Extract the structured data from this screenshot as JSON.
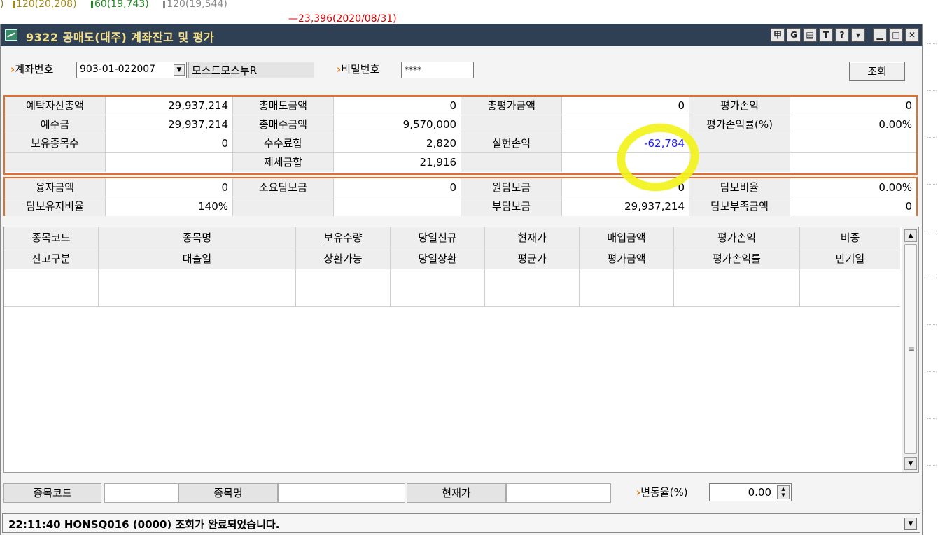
{
  "background": {
    "legend": [
      {
        "text": "120(20,208)",
        "color": "#a38a14"
      },
      {
        "text": "60(19,743)",
        "color": "#1f8a1f"
      },
      {
        "text": "120(19,544)",
        "color": "#8a8a8a"
      }
    ],
    "legend_prefix": ")",
    "annotation": "23,396(2020/08/31)"
  },
  "window": {
    "title": "9322 공매도(대주) 계좌잔고 및 평가",
    "buttons": [
      {
        "name": "pin-icon",
        "glyph": "甲"
      },
      {
        "name": "currency-icon",
        "glyph": "G"
      },
      {
        "name": "print-icon",
        "glyph": "▤"
      },
      {
        "name": "text-icon",
        "glyph": "T"
      },
      {
        "name": "help-icon",
        "glyph": "?"
      },
      {
        "name": "menu-icon",
        "glyph": "▾"
      },
      {
        "name": "minimize-icon",
        "glyph": "▁"
      },
      {
        "name": "maximize-icon",
        "glyph": "□"
      },
      {
        "name": "close-icon",
        "glyph": "✕"
      }
    ]
  },
  "query": {
    "account_label": "계좌번호",
    "account_value": "903-01-022007",
    "account_name": "모스트모스투R",
    "password_label": "비밀번호",
    "password_value": "****",
    "query_button": "조회"
  },
  "summary": {
    "rows": [
      [
        "예탁자산총액",
        "29,937,214",
        "총매도금액",
        "0",
        "총평가금액",
        "0",
        "평가손익",
        "0"
      ],
      [
        "예수금",
        "29,937,214",
        "총매수금액",
        "9,570,000",
        "",
        "",
        "평가손익률(%)",
        "0.00%"
      ],
      [
        "보유종목수",
        "0",
        "수수료합",
        "2,820",
        "실현손익",
        "-62,784",
        "",
        ""
      ],
      [
        "",
        "",
        "제세금합",
        "21,916",
        "",
        "",
        "",
        ""
      ]
    ],
    "rows2": [
      [
        "융자금액",
        "0",
        "소요담보금",
        "0",
        "원담보금",
        "0",
        "담보비율",
        "0.00%"
      ],
      [
        "담보유지비율",
        "140%",
        "",
        "",
        "부담보금",
        "29,937,214",
        "담보부족금액",
        "0"
      ]
    ]
  },
  "grid": {
    "header1": [
      "종목코드",
      "종목명",
      "보유수량",
      "당일신규",
      "현재가",
      "매입금액",
      "평가손익",
      "비중"
    ],
    "header2": [
      "잔고구분",
      "대출일",
      "상환가능",
      "당일상환",
      "평균가",
      "평가금액",
      "평가손익률",
      "만기일"
    ]
  },
  "filter": {
    "code_label": "종목코드",
    "code_value": "",
    "name_label": "종목명",
    "name_value": "",
    "price_label": "현재가",
    "price_value": "",
    "rate_label": "변동율(%)",
    "rate_value": "0.00"
  },
  "status": {
    "message": "22:11:40 HONSQ016 (0000) 조회가 완료되었습니다."
  }
}
